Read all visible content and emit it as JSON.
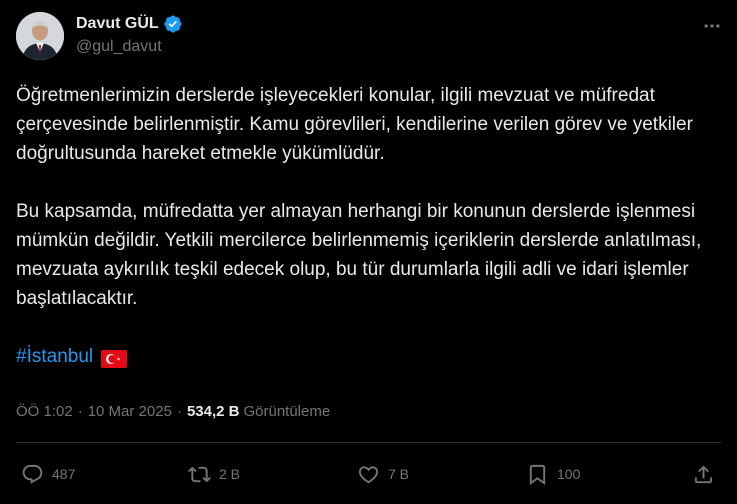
{
  "author": {
    "display_name": "Davut GÜL",
    "handle": "@gul_davut",
    "avatar_icon": "profile-photo",
    "verified_color": "#1d9bf0"
  },
  "tweet": {
    "paragraphs": [
      "Öğretmenlerimizin derslerde işleyecekleri konular, ilgili mevzuat ve müfredat çerçevesinde belirlenmiştir. Kamu görevlileri, kendilerine verilen görev ve yetkiler doğrultusunda hareket etmekle yükümlüdür.",
      "Bu kapsamda, müfredatta yer almayan herhangi bir konunun derslerde işlenmesi mümkün değildir. Yetkili mercilerce belirlenmemiş içeriklerin derslerde anlatılması, mevzuata aykırılık teşkil edecek olup, bu tür durumlarla ilgili adli ve idari işlemler başlatılacaktır."
    ],
    "hashtag": "#İstanbul",
    "flag_icon": "turkey-flag"
  },
  "meta": {
    "time": "ÖÖ 1:02",
    "date": "10 Mar 2025",
    "separator": "·",
    "views_count": "534,2 B",
    "views_label": "Görüntüleme"
  },
  "actions": {
    "replies": "487",
    "reposts": "2 B",
    "likes": "7 B",
    "bookmarks": "100"
  },
  "colors": {
    "background": "#000000",
    "text": "#e7e9ea",
    "secondary": "#71767b",
    "accent": "#1d9bf0",
    "divider": "#2f3336"
  }
}
